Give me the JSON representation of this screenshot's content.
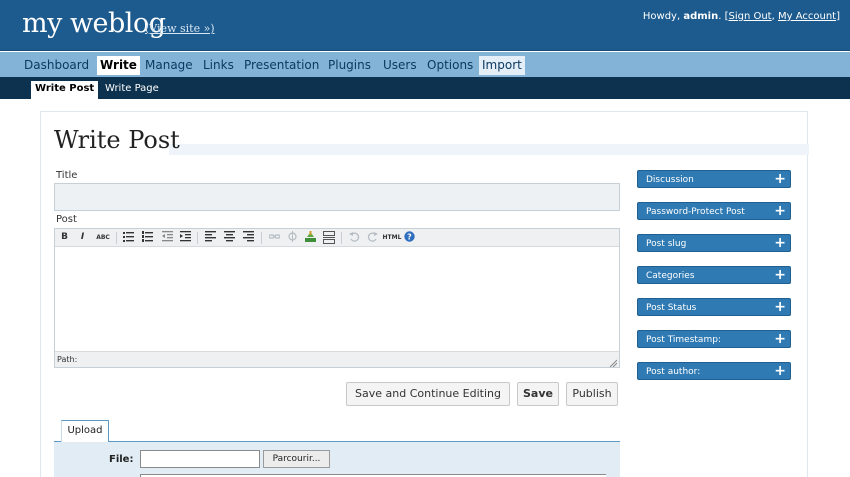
{
  "header": {
    "site_title": "my weblog",
    "view_site": "(View site »)",
    "howdy": "Howdy,",
    "username": "admin",
    "period": ".",
    "sign_out": "Sign Out",
    "separator": ",",
    "my_account": "My Account",
    "bracket_open": "[",
    "bracket_close": "]"
  },
  "menu": {
    "items": [
      {
        "label": "Dashboard"
      },
      {
        "label": "Write"
      },
      {
        "label": "Manage"
      },
      {
        "label": "Links"
      },
      {
        "label": "Presentation"
      },
      {
        "label": "Plugins"
      },
      {
        "label": "Users"
      },
      {
        "label": "Options"
      },
      {
        "label": "Import"
      }
    ],
    "active": "Write"
  },
  "submenu": {
    "items": [
      {
        "label": "Write Post"
      },
      {
        "label": "Write Page"
      }
    ],
    "active": "Write Post"
  },
  "main": {
    "page_title": "Write Post",
    "title_label": "Title",
    "title_value": "",
    "post_label": "Post",
    "path_label": "Path:",
    "buttons": {
      "save_continue": "Save and Continue Editing",
      "save": "Save",
      "publish": "Publish"
    },
    "toolbar": {
      "bold": "B",
      "italic": "I",
      "strike": "ABC",
      "html": "HTML",
      "icons": [
        "bold-icon",
        "italic-icon",
        "strikethrough-icon",
        "bullet-list-icon",
        "numbered-list-icon",
        "outdent-icon",
        "indent-icon",
        "align-left-icon",
        "align-center-icon",
        "align-right-icon",
        "link-icon",
        "unlink-icon",
        "image-icon",
        "more-icon",
        "undo-icon",
        "redo-icon",
        "html-icon",
        "help-icon"
      ]
    },
    "upload": {
      "tab": "Upload",
      "file_label": "File:",
      "browse": "Parcourir..."
    }
  },
  "sidebar": {
    "panels": [
      {
        "title": "Discussion"
      },
      {
        "title": "Password-Protect Post"
      },
      {
        "title": "Post slug"
      },
      {
        "title": "Categories"
      },
      {
        "title": "Post Status"
      },
      {
        "title": "Post Timestamp:"
      },
      {
        "title": "Post author:"
      }
    ],
    "expand_symbol": "+"
  },
  "colors": {
    "header_bg": "#1d5b8e",
    "menu_bg": "#83b4d8",
    "submenu_bg": "#0d324f",
    "panel_bg": "#2f7ab3",
    "upload_bg": "#e1ecf4"
  }
}
